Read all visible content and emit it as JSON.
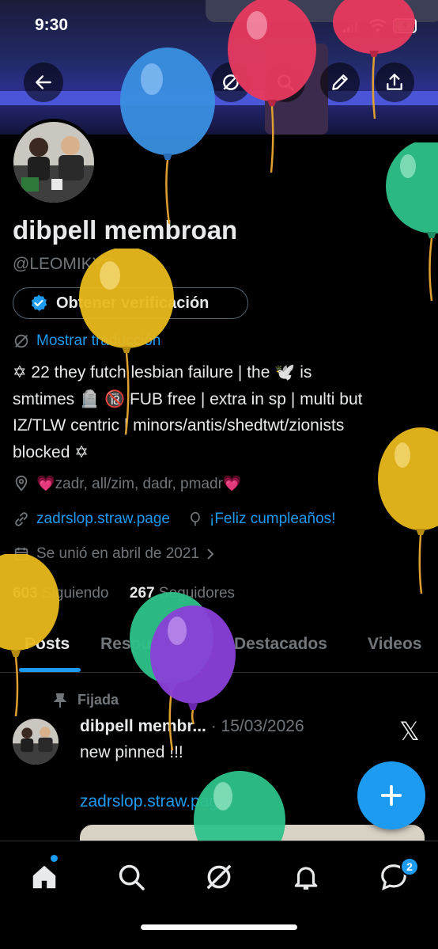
{
  "status_bar": {
    "time": "9:30"
  },
  "profile": {
    "name": "dibpell membroan",
    "handle": "@LEOMIKYS",
    "verify_button": "Obtener verificación",
    "translate_link": "Mostrar traducción",
    "bio_lines": [
      "✡ 22 they futch lesbian failure | the 🕊️ is",
      "smtimes 🪦 🔞 FUB free | extra in sp | multi but",
      "IZ/TLW centric | minors/antis/shedtwt/zionists",
      "blocked ✡"
    ],
    "location": "💗zadr, all/zim, dadr, pmadr💗",
    "website": "zadrslop.straw.page",
    "birthday": "¡Feliz cumpleaños!",
    "joined": "Se unió en abril de 2021",
    "following_count": "603",
    "following_label": "Siguiendo",
    "followers_count": "267",
    "followers_label": "Seguidores"
  },
  "tabs": [
    "Posts",
    "Respuestas",
    "Destacados",
    "Videos"
  ],
  "active_tab": "Posts",
  "pinned_post": {
    "pinned_label": "Fijada",
    "author": "dibpell membr...",
    "date": "· 15/03/2026",
    "text": "new pinned !!!",
    "link": "zadrslop.straw.page"
  },
  "bottom_nav": {
    "items": [
      "home-icon",
      "search-icon",
      "grok-icon",
      "notifications-icon",
      "messages-icon"
    ],
    "messages_badge": "2"
  },
  "colors": {
    "accent": "#1d9bf0",
    "background": "#000000",
    "muted": "#71767b"
  }
}
